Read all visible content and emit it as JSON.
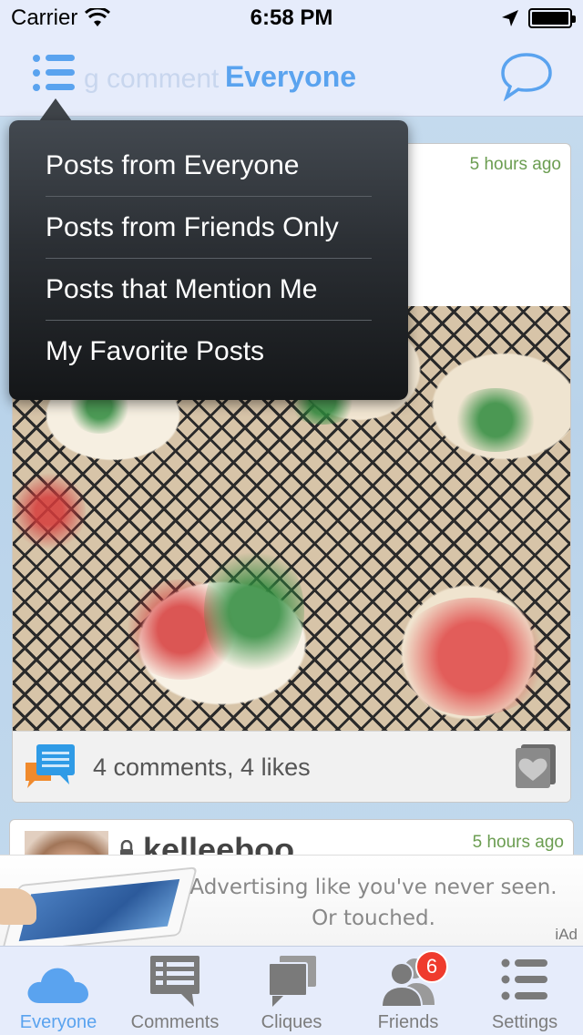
{
  "status_bar": {
    "carrier": "Carrier",
    "time": "6:58 PM"
  },
  "nav": {
    "ghost_text": "g comment",
    "title": "Everyone"
  },
  "menu": {
    "items": [
      {
        "label": "Posts from Everyone"
      },
      {
        "label": "Posts from Friends Only"
      },
      {
        "label": "Posts that Mention Me"
      },
      {
        "label": "My Favorite Posts"
      }
    ]
  },
  "posts": [
    {
      "time": "5 hours ago",
      "footer": "4 comments, 4 likes"
    },
    {
      "username": "kelleeboo",
      "time": "5 hours ago"
    }
  ],
  "ad": {
    "line1": "Advertising like you've never seen.",
    "line2": "Or touched.",
    "label": "iAd"
  },
  "tabs": [
    {
      "label": "Everyone",
      "icon": "cloud-icon",
      "active": true
    },
    {
      "label": "Comments",
      "icon": "comments-icon"
    },
    {
      "label": "Cliques",
      "icon": "cliques-icon"
    },
    {
      "label": "Friends",
      "icon": "friends-icon",
      "badge": "6"
    },
    {
      "label": "Settings",
      "icon": "list-icon"
    }
  ],
  "colors": {
    "accent": "#5aa3ef",
    "time_green": "#6b9d51",
    "badge_red": "#ef3b2d",
    "menu_dark": "#2b2f34"
  }
}
